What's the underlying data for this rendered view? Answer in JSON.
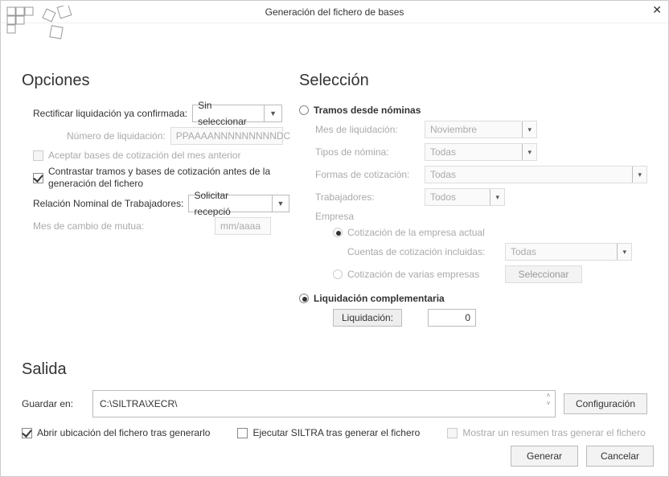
{
  "window": {
    "title": "Generación del fichero de bases"
  },
  "opciones": {
    "heading": "Opciones",
    "rectificar_label": "Rectificar liquidación ya confirmada:",
    "rectificar_value": "Sin seleccionar",
    "num_liq_label": "Número de liquidación:",
    "num_liq_placeholder": "PPAAAANNNNNNNNNDC",
    "aceptar_bases": "Aceptar bases de cotización del mes anterior",
    "contrastar": "Contrastar tramos y bases de cotización antes de la generación del fichero",
    "relacion_label": "Relación Nominal de Trabajadores:",
    "relacion_value": "Solicitar recepció",
    "mes_mutua_label": "Mes de cambio de mutua:",
    "mes_mutua_placeholder": "mm/aaaa"
  },
  "seleccion": {
    "heading": "Selección",
    "tramos_radio": "Tramos desde nóminas",
    "mes_liq_label": "Mes de liquidación:",
    "mes_liq_value": "Noviembre",
    "tipos_label": "Tipos de nómina:",
    "tipos_value": "Todas",
    "formas_label": "Formas de cotización:",
    "formas_value": "Todas",
    "trabajadores_label": "Trabajadores:",
    "trabajadores_value": "Todos",
    "empresa_label": "Empresa",
    "cot_actual": "Cotización de la empresa actual",
    "cuentas_label": "Cuentas de cotización incluidas:",
    "cuentas_value": "Todas",
    "cot_varias": "Cotización de varias empresas",
    "seleccionar_btn": "Seleccionar",
    "liq_comp_radio": "Liquidación complementaria",
    "liq_btn": "Liquidación:",
    "liq_value": "0"
  },
  "salida": {
    "heading": "Salida",
    "guardar_label": "Guardar en:",
    "guardar_path": "C:\\SILTRA\\XECR\\",
    "config_btn": "Configuración",
    "abrir_ubic": "Abrir ubicación del fichero tras generarlo",
    "ejecutar_siltra": "Ejecutar SILTRA tras generar el fichero",
    "mostrar_resumen": "Mostrar un resumen tras generar el fichero"
  },
  "footer": {
    "generar": "Generar",
    "cancelar": "Cancelar"
  }
}
